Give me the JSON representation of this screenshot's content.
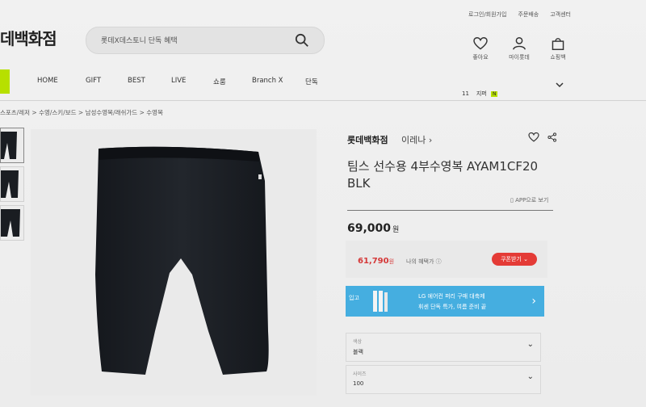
{
  "header": {
    "logo": "데백화점",
    "util_links": [
      "로그인/회원가입",
      "주문배송",
      "고객센터"
    ],
    "search": {
      "placeholder": "롯데X데스토니 단독 혜택"
    },
    "icons": [
      {
        "name": "heart-icon",
        "label": "좋아요"
      },
      {
        "name": "user-icon",
        "label": "마이롯데"
      },
      {
        "name": "bag-icon",
        "label": "쇼핑백"
      }
    ]
  },
  "nav": {
    "items": [
      "HOME",
      "GIFT",
      "BEST",
      "LIVE",
      "쇼룸",
      "Branch X",
      "단독"
    ],
    "rank": {
      "number": "11",
      "text": "지퍼",
      "badge": "N"
    }
  },
  "breadcrumb": "스포츠/레저 > 수영/스키/보드 > 남성수영복/래쉬가드 > 수영복",
  "product": {
    "brand": "롯데백화점",
    "seller": "이레나 ›",
    "title": "팀스 선수용 4부수영복 AYAM1CF20 BLK",
    "app_view": "APP으로 보기",
    "price": "69,000",
    "currency": "원",
    "coupon_price": "61,790",
    "coupon_unit": "원",
    "coupon_note": "나의 혜택가 ⓘ",
    "coupon_button": "쿠폰받기",
    "banner": {
      "left_text": "입고",
      "line1": "LG 에어컨 퍼리 구매 대축제",
      "line2": "휘센 단독 특가, 여름 준비 끝"
    },
    "options": [
      {
        "label": "색상",
        "value": "블랙"
      },
      {
        "label": "사이즈",
        "value": "100"
      }
    ]
  },
  "colors": {
    "accent_green": "#b7e000",
    "coupon_red": "#e43b36",
    "banner_blue": "#45aee0",
    "price_red": "#d53838"
  }
}
